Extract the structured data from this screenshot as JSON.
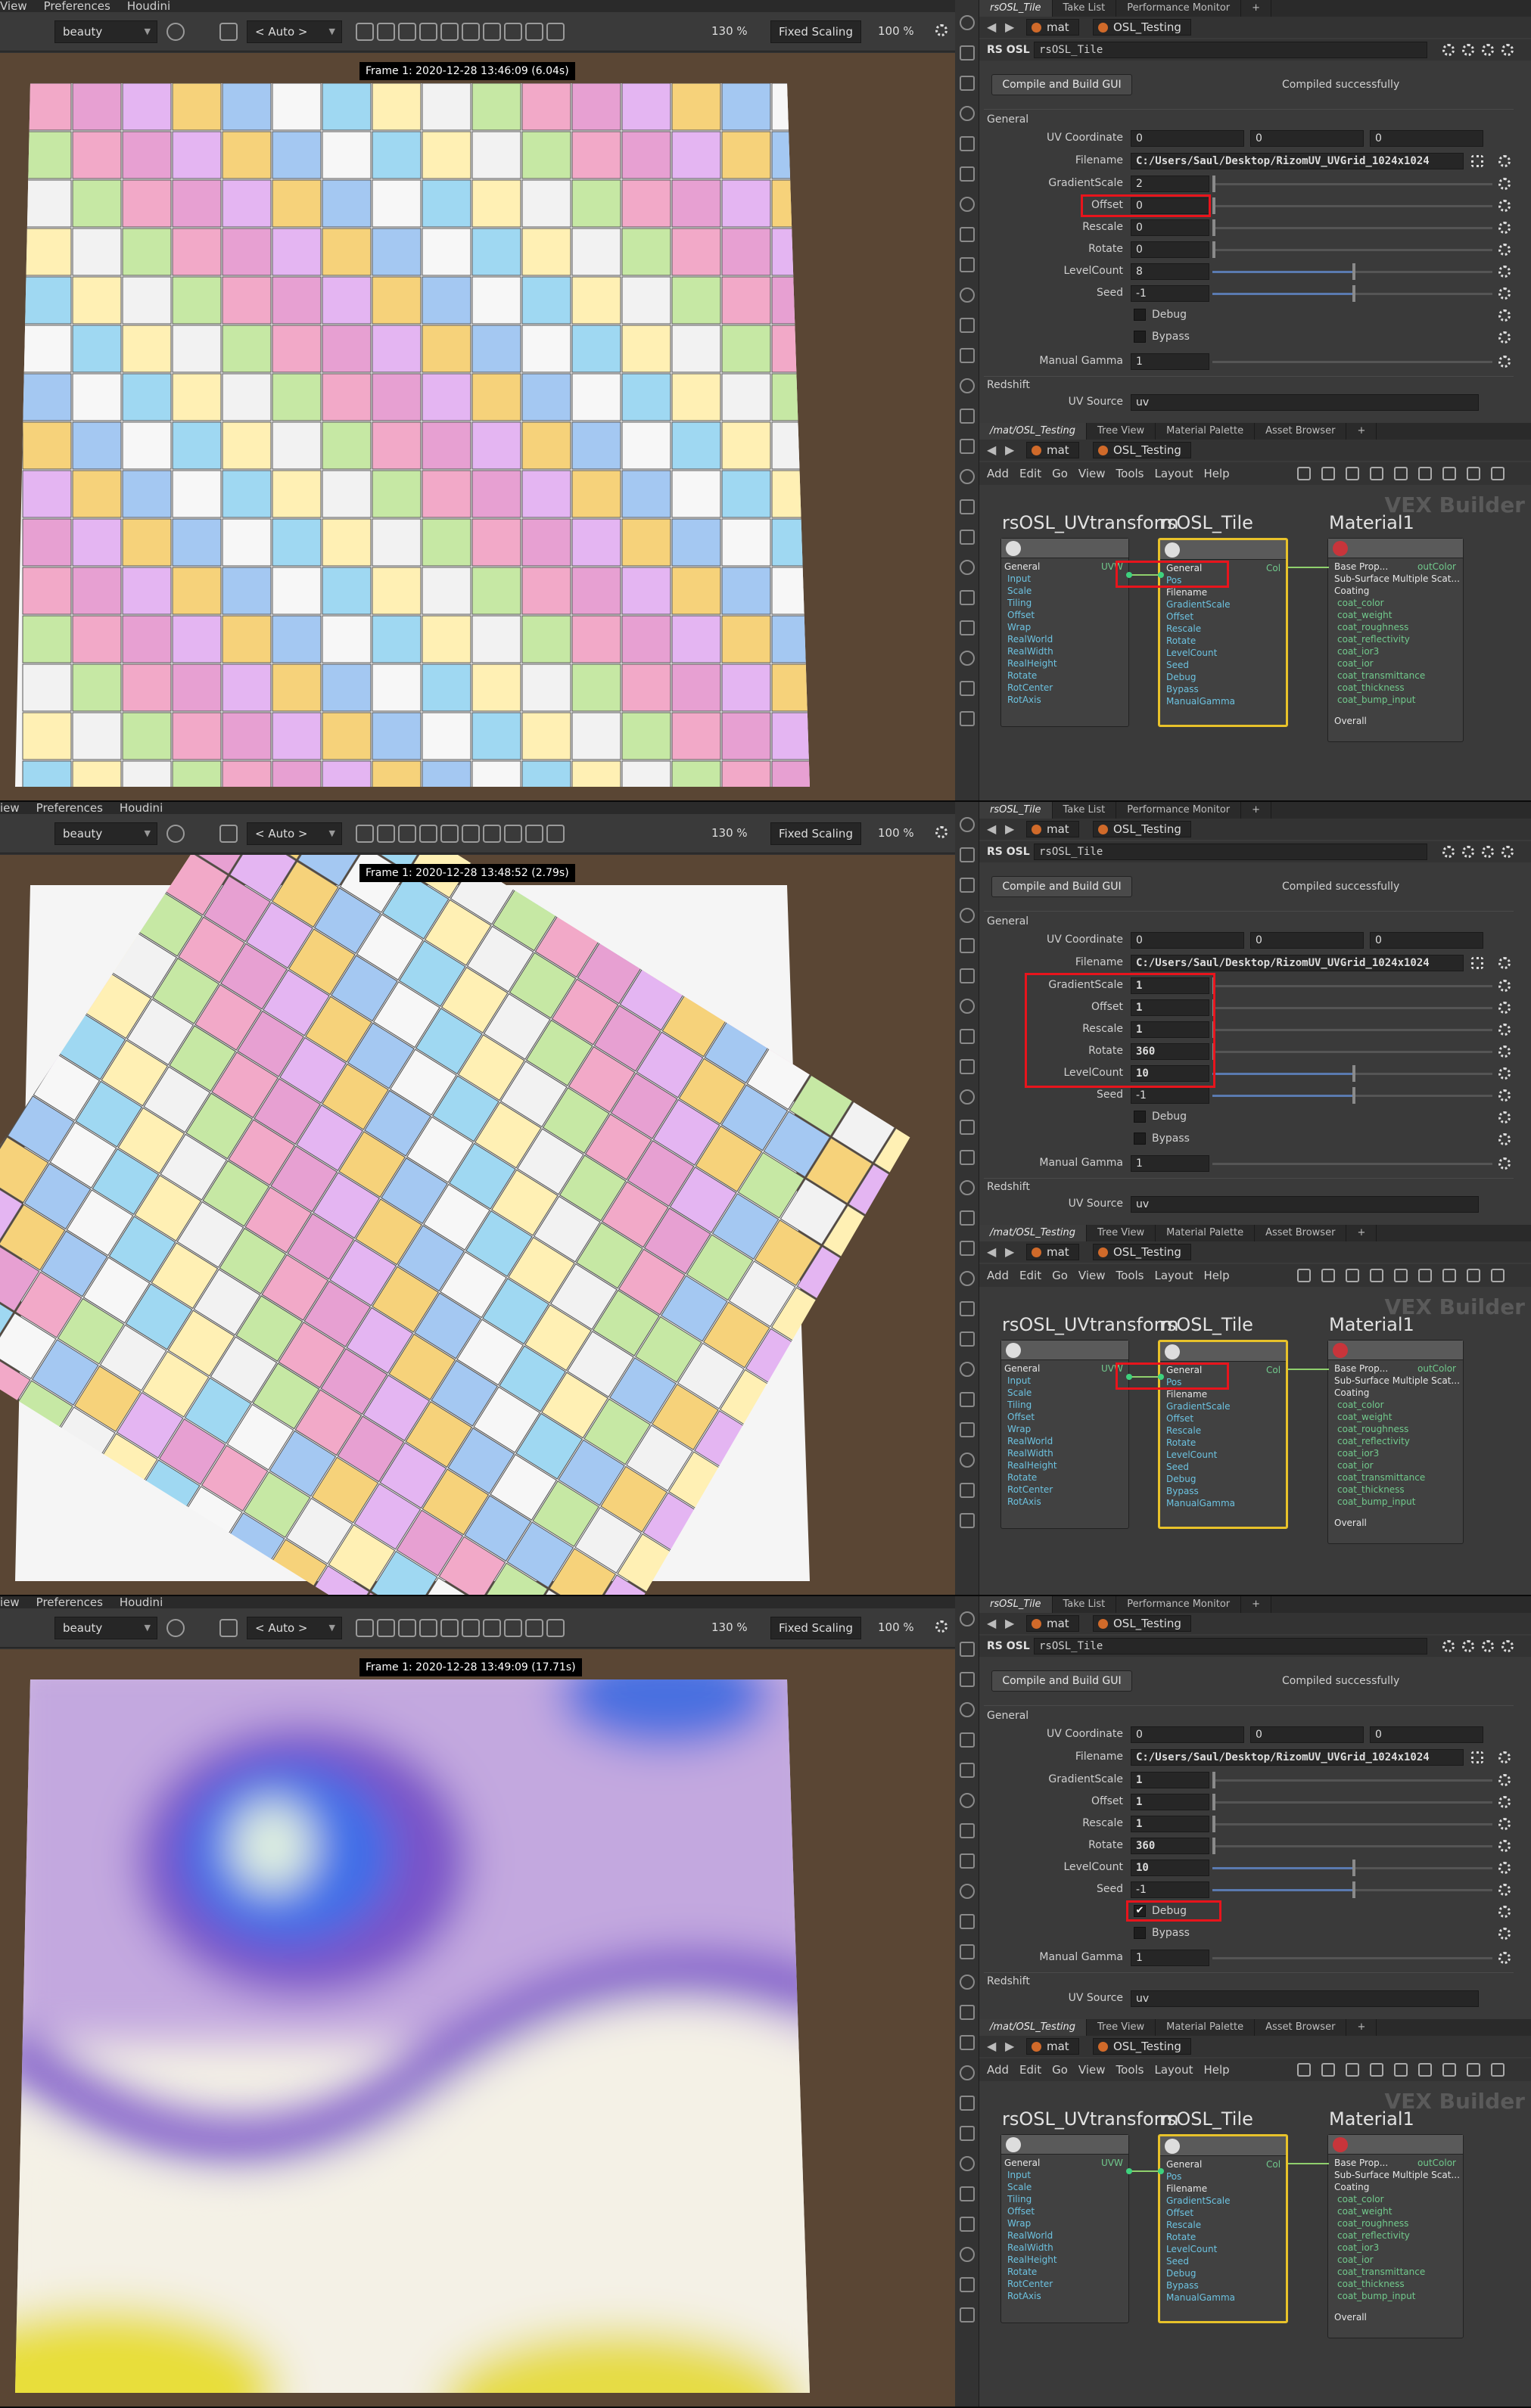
{
  "colors": {
    "highlight": "#e8141c",
    "selected_node": "#e8c22a",
    "port_input": "#6cc2e0",
    "port_output": "#71c98c"
  },
  "panels": [
    {
      "menu": [
        "View",
        "Preferences",
        "Houdini"
      ],
      "viewport": {
        "aov": "beauty",
        "camera": "< Auto >",
        "zoom": "130 %",
        "scaling": "Fixed Scaling",
        "percent": "100 %",
        "stamp": "Frame 1: 2020-12-28 13:46:09 (6.04s)",
        "render": "grid-tiles"
      },
      "tabs": [
        "rsOSL_Tile",
        "Take List",
        "Performance Monitor",
        "+"
      ],
      "path": {
        "root": "mat",
        "node": "OSL_Testing"
      },
      "node_type": "RS OSL",
      "node_name": "rsOSL_Tile",
      "compile_button": "Compile and Build GUI",
      "compile_status": "Compiled successfully",
      "section_general": "General",
      "uv_label": "UV Coordinate",
      "uv_values": [
        "0",
        "0",
        "0"
      ],
      "filename_label": "Filename",
      "filename": "C:/Users/Saul/Desktop/RizomUV_UVGrid_1024x1024",
      "params": [
        {
          "label": "GradientScale",
          "value": "2"
        },
        {
          "label": "Offset",
          "value": "0"
        },
        {
          "label": "Rescale",
          "value": "0"
        },
        {
          "label": "Rotate",
          "value": "0"
        },
        {
          "label": "LevelCount",
          "value": "8"
        },
        {
          "label": "Seed",
          "value": "-1"
        }
      ],
      "debug_label": "Debug",
      "bypass_label": "Bypass",
      "debug_checked": false,
      "gamma_label": "Manual Gamma",
      "gamma_value": "1",
      "section_redshift": "Redshift",
      "uvsource_label": "UV Source",
      "uvsource_value": "uv",
      "ne_tabs": [
        "/mat/OSL_Testing",
        "Tree View",
        "Material Palette",
        "Asset Browser",
        "+"
      ],
      "ne_menu": [
        "Add",
        "Edit",
        "Go",
        "View",
        "Tools",
        "Layout",
        "Help"
      ],
      "watermark": "VEX Builder",
      "nodes": {
        "uvt": {
          "title": "rsOSL_UVtransform",
          "group": "General",
          "out": "UVW",
          "inputs": [
            "Input",
            "Scale",
            "Tiling",
            "Offset",
            "Wrap",
            "RealWorld",
            "RealWidth",
            "RealHeight",
            "Rotate",
            "RotCenter",
            "RotAxis"
          ]
        },
        "tile": {
          "title": "rsOSL_Tile",
          "group": "General",
          "pos": "Pos",
          "filename": "Filename",
          "out": "Col",
          "inputs": [
            "GradientScale",
            "Offset",
            "Rescale",
            "Rotate",
            "LevelCount",
            "Seed",
            "Debug",
            "Bypass",
            "ManualGamma"
          ]
        },
        "mat": {
          "title": "Material1",
          "base": "Base Prop...",
          "out": "outColor",
          "sss": "Sub-Surface Multiple Scat...",
          "coating": "Coating",
          "inputs": [
            "coat_color",
            "coat_weight",
            "coat_roughness",
            "coat_reflectivity",
            "coat_ior3",
            "coat_ior",
            "coat_transmittance",
            "coat_thickness",
            "coat_bump_input"
          ],
          "overall": "Overall"
        }
      }
    },
    {
      "menu": [
        "iew",
        "Preferences",
        "Houdini"
      ],
      "viewport": {
        "aov": "beauty",
        "camera": "< Auto >",
        "zoom": "130 %",
        "scaling": "Fixed Scaling",
        "percent": "100 %",
        "stamp": "Frame 1: 2020-12-28 13:48:52 (2.79s)",
        "render": "rotated-tiles"
      },
      "tabs": [
        "rsOSL_Tile",
        "Take List",
        "Performance Monitor",
        "+"
      ],
      "path": {
        "root": "mat",
        "node": "OSL_Testing"
      },
      "node_type": "RS OSL",
      "node_name": "rsOSL_Tile",
      "compile_button": "Compile and Build GUI",
      "compile_status": "Compiled successfully",
      "section_general": "General",
      "uv_label": "UV Coordinate",
      "uv_values": [
        "0",
        "0",
        "0"
      ],
      "filename_label": "Filename",
      "filename": "C:/Users/Saul/Desktop/RizomUV_UVGrid_1024x1024",
      "params": [
        {
          "label": "GradientScale",
          "value": "1"
        },
        {
          "label": "Offset",
          "value": "1"
        },
        {
          "label": "Rescale",
          "value": "1"
        },
        {
          "label": "Rotate",
          "value": "360"
        },
        {
          "label": "LevelCount",
          "value": "10"
        },
        {
          "label": "Seed",
          "value": "-1"
        }
      ],
      "debug_label": "Debug",
      "bypass_label": "Bypass",
      "debug_checked": false,
      "gamma_label": "Manual Gamma",
      "gamma_value": "1",
      "section_redshift": "Redshift",
      "uvsource_label": "UV Source",
      "uvsource_value": "uv",
      "ne_tabs": [
        "/mat/OSL_Testing",
        "Tree View",
        "Material Palette",
        "Asset Browser",
        "+"
      ],
      "ne_menu": [
        "Add",
        "Edit",
        "Go",
        "View",
        "Tools",
        "Layout",
        "Help"
      ],
      "watermark": "VEX Builder",
      "nodes": {
        "uvt": {
          "title": "rsOSL_UVtransform",
          "group": "General",
          "out": "UVW",
          "inputs": [
            "Input",
            "Scale",
            "Tiling",
            "Offset",
            "Wrap",
            "RealWorld",
            "RealWidth",
            "RealHeight",
            "Rotate",
            "RotCenter",
            "RotAxis"
          ]
        },
        "tile": {
          "title": "rsOSL_Tile",
          "group": "General",
          "pos": "Pos",
          "filename": "Filename",
          "out": "Col",
          "inputs": [
            "GradientScale",
            "Offset",
            "Rescale",
            "Rotate",
            "LevelCount",
            "Seed",
            "Debug",
            "Bypass",
            "ManualGamma"
          ]
        },
        "mat": {
          "title": "Material1",
          "base": "Base Prop...",
          "out": "outColor",
          "sss": "Sub-Surface Multiple Scat...",
          "coating": "Coating",
          "inputs": [
            "coat_color",
            "coat_weight",
            "coat_roughness",
            "coat_reflectivity",
            "coat_ior3",
            "coat_ior",
            "coat_transmittance",
            "coat_thickness",
            "coat_bump_input"
          ],
          "overall": "Overall"
        }
      }
    },
    {
      "menu": [
        "iew",
        "Preferences",
        "Houdini"
      ],
      "viewport": {
        "aov": "beauty",
        "camera": "< Auto >",
        "zoom": "130 %",
        "scaling": "Fixed Scaling",
        "percent": "100 %",
        "stamp": "Frame 1: 2020-12-28 13:49:09 (17.71s)",
        "render": "noise-debug"
      },
      "tabs": [
        "rsOSL_Tile",
        "Take List",
        "Performance Monitor",
        "+"
      ],
      "path": {
        "root": "mat",
        "node": "OSL_Testing"
      },
      "node_type": "RS OSL",
      "node_name": "rsOSL_Tile",
      "compile_button": "Compile and Build GUI",
      "compile_status": "Compiled successfully",
      "section_general": "General",
      "uv_label": "UV Coordinate",
      "uv_values": [
        "0",
        "0",
        "0"
      ],
      "filename_label": "Filename",
      "filename": "C:/Users/Saul/Desktop/RizomUV_UVGrid_1024x1024",
      "params": [
        {
          "label": "GradientScale",
          "value": "1"
        },
        {
          "label": "Offset",
          "value": "1"
        },
        {
          "label": "Rescale",
          "value": "1"
        },
        {
          "label": "Rotate",
          "value": "360"
        },
        {
          "label": "LevelCount",
          "value": "10"
        },
        {
          "label": "Seed",
          "value": "-1"
        }
      ],
      "debug_label": "Debug",
      "bypass_label": "Bypass",
      "debug_checked": true,
      "gamma_label": "Manual Gamma",
      "gamma_value": "1",
      "section_redshift": "Redshift",
      "uvsource_label": "UV Source",
      "uvsource_value": "uv",
      "ne_tabs": [
        "/mat/OSL_Testing",
        "Tree View",
        "Material Palette",
        "Asset Browser",
        "+"
      ],
      "ne_menu": [
        "Add",
        "Edit",
        "Go",
        "View",
        "Tools",
        "Layout",
        "Help"
      ],
      "watermark": "VEX Builder",
      "nodes": {
        "uvt": {
          "title": "rsOSL_UVtransform",
          "group": "General",
          "out": "UVW",
          "inputs": [
            "Input",
            "Scale",
            "Tiling",
            "Offset",
            "Wrap",
            "RealWorld",
            "RealWidth",
            "RealHeight",
            "Rotate",
            "RotCenter",
            "RotAxis"
          ]
        },
        "tile": {
          "title": "rsOSL_Tile",
          "group": "General",
          "pos": "Pos",
          "filename": "Filename",
          "out": "Col",
          "inputs": [
            "GradientScale",
            "Offset",
            "Rescale",
            "Rotate",
            "LevelCount",
            "Seed",
            "Debug",
            "Bypass",
            "ManualGamma"
          ]
        },
        "mat": {
          "title": "Material1",
          "base": "Base Prop...",
          "out": "outColor",
          "sss": "Sub-Surface Multiple Scat...",
          "coating": "Coating",
          "inputs": [
            "coat_color",
            "coat_weight",
            "coat_roughness",
            "coat_reflectivity",
            "coat_ior3",
            "coat_ior",
            "coat_transmittance",
            "coat_thickness",
            "coat_bump_input"
          ],
          "overall": "Overall"
        }
      }
    }
  ]
}
